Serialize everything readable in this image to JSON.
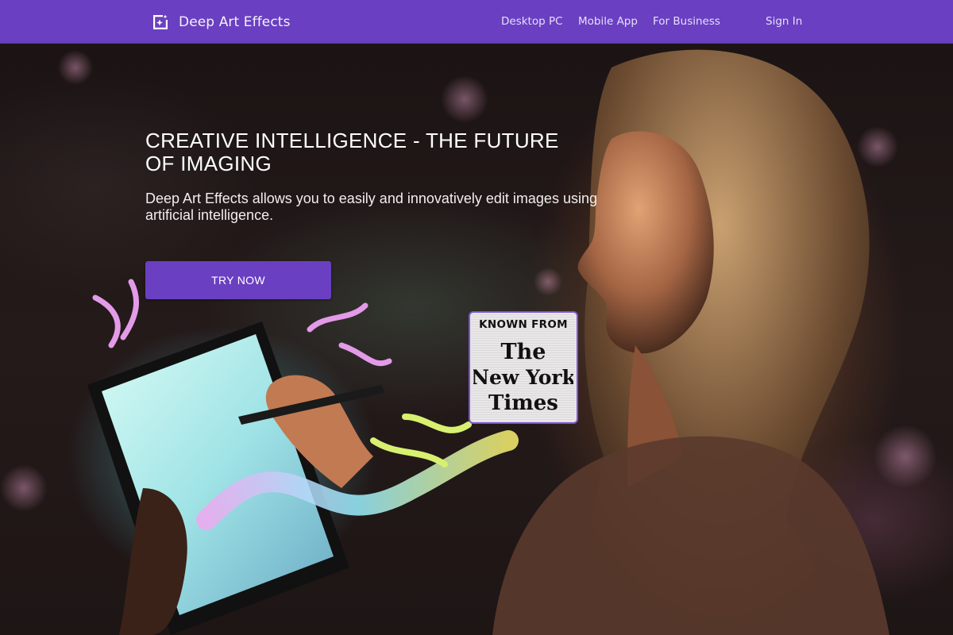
{
  "colors": {
    "brand": "#6a3fc1",
    "text_light": "#ffffff",
    "badge_border": "#7a55d4"
  },
  "navbar": {
    "brand_icon": "sparkle-image-icon",
    "brand_name": "Deep Art Effects",
    "links": [
      {
        "label": "Desktop PC"
      },
      {
        "label": "Mobile App"
      },
      {
        "label": "For Business"
      }
    ],
    "sign_in_label": "Sign In"
  },
  "hero": {
    "title": "CREATIVE INTELLIGENCE - THE FUTURE OF IMAGING",
    "subtitle": "Deep Art Effects allows you to easily and innovatively edit images using artificial intelligence.",
    "cta_label": "TRY NOW",
    "background_image": "woman-drawing-on-glowing-tablet-with-paint-splash",
    "badge": {
      "label": "KNOWN FROM",
      "logo": "The New York Times",
      "logo_lines": [
        "The",
        "New York",
        "Times"
      ]
    }
  }
}
